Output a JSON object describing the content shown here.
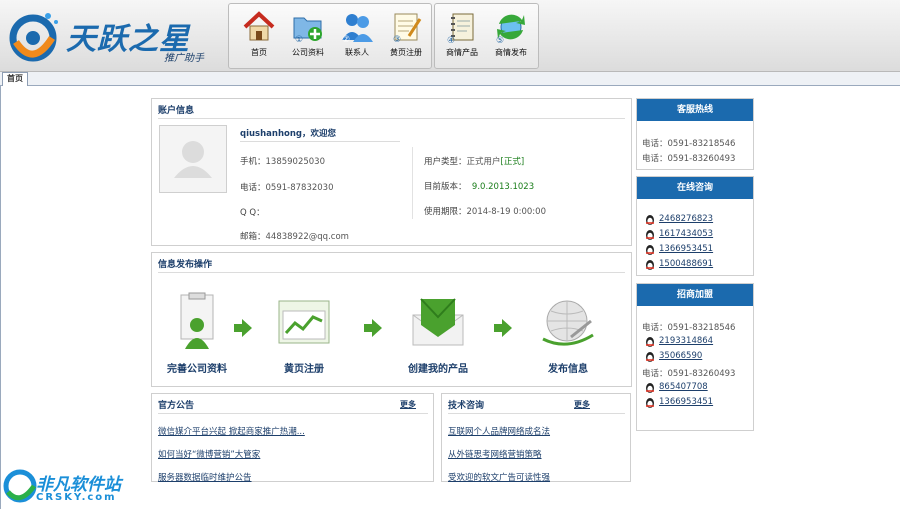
{
  "app": {
    "logo_text": "天跃之星",
    "logo_sub": "推广助手"
  },
  "toolbar": [
    {
      "label": "首页",
      "icon": "home-icon",
      "num": ""
    },
    {
      "label": "公司资料",
      "icon": "folder-add-icon",
      "num": "①"
    },
    {
      "label": "联系人",
      "icon": "contacts-icon",
      "num": "②"
    },
    {
      "label": "黄页注册",
      "icon": "notepad-pen-icon",
      "num": "③"
    },
    {
      "label": "商情产品",
      "icon": "notebook-icon",
      "num": "④"
    },
    {
      "label": "商情发布",
      "icon": "refresh-globe-icon",
      "num": "⑤"
    }
  ],
  "tabs": {
    "home": "首页"
  },
  "account": {
    "title": "账户信息",
    "greeting": "qiushanhong，欢迎您",
    "phone_label": "手机：",
    "phone": "13859025030",
    "tel_label": "电话：",
    "tel": "0591-87832030",
    "qq_label": "Q Q：",
    "qq": "",
    "email_label": "邮箱：",
    "email": "44838922@qq.com",
    "type_label": "用户类型：",
    "type": "正式用户",
    "type_flag": "[正式]",
    "version_label": "目前版本：",
    "version": "9.0.2013.1023",
    "expire_label": "使用期限：",
    "expire": "2014-8-19 0:00:00"
  },
  "publish": {
    "title": "信息发布操作",
    "steps": [
      "完善公司资料",
      "黄页注册",
      "创建我的产品",
      "发布信息"
    ]
  },
  "notice": {
    "title": "官方公告",
    "more": "更多",
    "items": [
      "微信媒介平台兴起 掀起商家推广热潮...",
      "如何当好“微博营销”大管家",
      "服务器数据临时维护公告"
    ]
  },
  "tech": {
    "title": "技术咨询",
    "more": "更多",
    "items": [
      "互联网个人品牌网络成名法",
      "从外链思考网络营销策略",
      "受欢迎的软文广告可读性强"
    ]
  },
  "hotline": {
    "title": "客服热线",
    "lines": [
      "电话：0591-83218546",
      "电话：0591-83260493"
    ]
  },
  "consult": {
    "title": "在线咨询",
    "qq": [
      "2468276823",
      "1617434053",
      "1366953451",
      "1500488691"
    ]
  },
  "join": {
    "title": "招商加盟",
    "tel1": "电话：0591-83218546",
    "qq1": [
      "2193314864",
      "35066590"
    ],
    "tel2": "电话：0591-83260493",
    "qq2": [
      "865407708",
      "1366953451"
    ]
  },
  "watermark": {
    "text": "非凡软件站",
    "sub": "CRSKY.com"
  },
  "colors": {
    "accent": "#1b6aae",
    "link": "#1d3f6b",
    "green": "#1a7d1a"
  }
}
